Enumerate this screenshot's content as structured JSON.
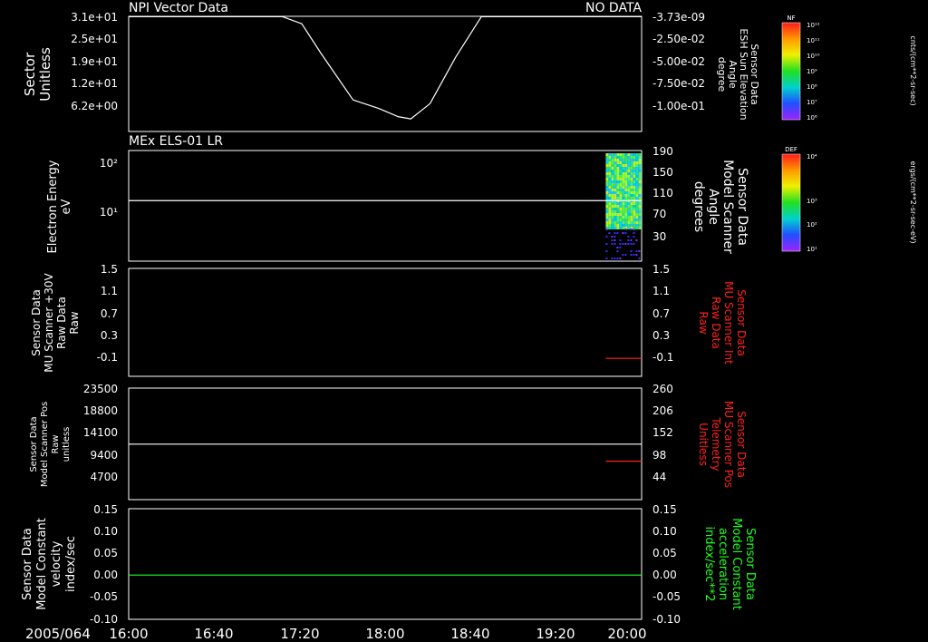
{
  "date_label": "2005/064",
  "xticks": [
    "16:00",
    "16:40",
    "17:20",
    "18:00",
    "18:40",
    "19:20",
    "20:00"
  ],
  "colors": {
    "foreground": "#ffffff",
    "red": "#ff2020",
    "green": "#20ff20",
    "background": "#000000"
  },
  "colorbars": [
    {
      "tag": "NF",
      "ticks": [
        "10¹²",
        "10¹¹",
        "10¹⁰",
        "10⁹",
        "10⁸",
        "10⁷",
        "10⁶"
      ],
      "unit": "cnts/(cm**2-sr-sec)"
    },
    {
      "tag": "DEF",
      "ticks": [
        "10⁴",
        "10³",
        "10²",
        "10¹"
      ],
      "unit": "ergs/(cm**2-sr-sec-eV)"
    }
  ],
  "chart_data": [
    {
      "type": "line",
      "title": "NPI Vector Data",
      "status": "NO DATA",
      "ylabel": [
        "Sector",
        "Unitless"
      ],
      "yticks_left": [
        "3.1e+01",
        "2.5e+01",
        "1.9e+01",
        "1.2e+01",
        "6.2e+00"
      ],
      "ylabel_right": [
        "Sensor Data",
        "ESH Sun Elevation",
        "Angle",
        "degree"
      ],
      "yticks_right": [
        "-3.73e-09",
        "-2.50e-02",
        "-5.00e-02",
        "-7.50e-02",
        "-1.00e-01"
      ],
      "xlim_hours": [
        16,
        20
      ],
      "ylim": [
        0,
        31
      ],
      "series": [
        {
          "color": "#ffffff",
          "x": [
            16.0,
            17.2,
            17.35,
            17.5,
            17.75,
            17.95,
            18.1,
            18.2,
            18.35,
            18.55,
            18.75,
            20.0
          ],
          "y": [
            30.9,
            30.9,
            29.0,
            21.0,
            8.5,
            6.2,
            4.0,
            3.4,
            7.5,
            20.0,
            30.9,
            30.9
          ]
        }
      ]
    },
    {
      "type": "heatmap",
      "title": "MEx ELS-01 LR",
      "ylabel": [
        "Electron Energy",
        "eV"
      ],
      "yticks_left": [
        "10²",
        "10¹"
      ],
      "ylabel_right": [
        "Sensor Data",
        "Model Scanner",
        "Angle",
        "degrees"
      ],
      "yticks_right": [
        "190",
        "150",
        "110",
        "70",
        "30"
      ],
      "xlim_hours": [
        16,
        20
      ],
      "data_start_hour": 19.72,
      "scanner_angle_line_deg": 110
    },
    {
      "type": "line",
      "ylabel": [
        "Sensor Data",
        "MU Scanner +30V",
        "Raw Data",
        "Raw"
      ],
      "yticks_left": [
        "1.5",
        "1.1",
        "0.7",
        "0.3",
        "-0.1"
      ],
      "ylabel_right": [
        "Sensor Data",
        "MU Scanner Int",
        "Raw Data",
        "Raw"
      ],
      "yticks_right": [
        "1.5",
        "1.1",
        "0.7",
        "0.3",
        "-0.1"
      ],
      "xlim_hours": [
        16,
        20
      ],
      "ylim": [
        -0.3,
        1.5
      ],
      "series": [
        {
          "color": "#ff2020",
          "x": [
            19.72,
            20.0
          ],
          "y": [
            0.0,
            0.0
          ]
        }
      ]
    },
    {
      "type": "line",
      "ylabel": [
        "Sensor Data",
        "Model Scanner Pos",
        "Raw",
        "unitless"
      ],
      "yticks_left": [
        "23500",
        "18800",
        "14100",
        "9400",
        "4700"
      ],
      "ylabel_right": [
        "Sensor Data",
        "MU Scanner Pos",
        "Telemetry",
        "Unitless"
      ],
      "yticks_right": [
        "260",
        "206",
        "152",
        "98",
        "44"
      ],
      "xlim_hours": [
        16,
        20
      ],
      "ylim": [
        0,
        23500
      ],
      "series": [
        {
          "color": "#ffffff",
          "x": [
            16.0,
            20.0
          ],
          "y": [
            11700,
            11700
          ]
        },
        {
          "color": "#ff2020",
          "x": [
            19.72,
            20.0
          ],
          "y": [
            8100,
            8100
          ]
        }
      ]
    },
    {
      "type": "line",
      "ylabel": [
        "Sensor Data",
        "Model Constant",
        "velocity",
        "index/sec"
      ],
      "yticks_left": [
        "0.15",
        "0.10",
        "0.05",
        "0.00",
        "-0.05",
        "-0.10"
      ],
      "ylabel_right": [
        "Sensor Data",
        "Model Constant",
        "acceleration",
        "index/sec**2"
      ],
      "yticks_right": [
        "0.15",
        "0.10",
        "0.05",
        "0.00",
        "-0.05",
        "-0.10"
      ],
      "xlim_hours": [
        16,
        20
      ],
      "ylim": [
        -0.1,
        0.15
      ],
      "series": [
        {
          "color": "#20ff20",
          "x": [
            16.0,
            20.0
          ],
          "y": [
            0.0,
            0.0
          ]
        }
      ]
    }
  ]
}
